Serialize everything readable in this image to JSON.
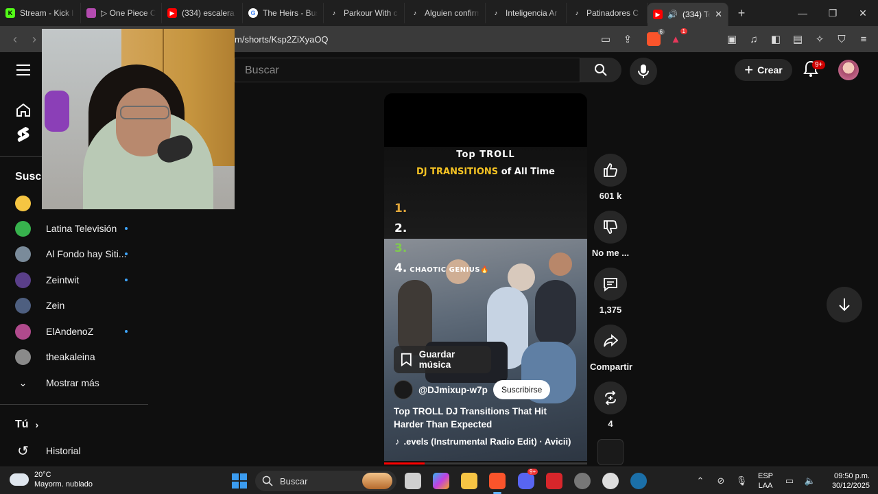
{
  "browser": {
    "tabs": [
      {
        "label": "Stream - Kick l",
        "fav": "kick",
        "color": "#53fc18"
      },
      {
        "label": "▷ One Piece C",
        "fav": "anime",
        "color": "#b44bb0"
      },
      {
        "label": "(334) escalera",
        "fav": "youtube",
        "color": "#ff0000"
      },
      {
        "label": "The Heirs - Bus",
        "fav": "google",
        "color": "#ffffff"
      },
      {
        "label": "Parkour With c",
        "fav": "tiktok",
        "color": "#000000"
      },
      {
        "label": "Alguien confirm",
        "fav": "tiktok",
        "color": "#000000"
      },
      {
        "label": "Inteligencia Ar",
        "fav": "tiktok",
        "color": "#000000"
      },
      {
        "label": "Patinadores C",
        "fav": "tiktok",
        "color": "#000000"
      },
      {
        "label": "(334) Te",
        "fav": "youtube",
        "color": "#ff0000",
        "active": true,
        "audio": true
      }
    ],
    "new_tab_icon": "plus-icon",
    "address": "m/shorts/Ksp2ZiXyaOQ",
    "brave_shield_count": "6",
    "rewards_count": "1"
  },
  "youtube": {
    "search_placeholder": "Buscar",
    "create_label": "Crear",
    "notifications_badge": "9+"
  },
  "sidebar": {
    "subscriptions_title": "Suscri",
    "subscriptions": [
      {
        "name": "",
        "color": "#f5c542",
        "new": false
      },
      {
        "name": "Latina Televisión",
        "color": "#37b24d",
        "new": true
      },
      {
        "name": "Al Fondo hay Siti...",
        "color": "#7a8b9a",
        "new": true
      },
      {
        "name": "Zeintwit",
        "color": "#5a3f8a",
        "new": true
      },
      {
        "name": "Zein",
        "color": "#4e5f80",
        "new": false
      },
      {
        "name": "ElAndenoZ",
        "color": "#b04a8c",
        "new": true
      },
      {
        "name": "theakaleina",
        "color": "#8a8a8a",
        "new": false
      }
    ],
    "show_more": "Mostrar más",
    "you_label": "Tú",
    "history_label": "Historial"
  },
  "short": {
    "overlay_line1": "Top TROLL",
    "overlay_line2_gold": "DJ TRANSITIONS",
    "overlay_line2_white": " of All Time",
    "ranks": [
      {
        "num": "1.",
        "color": "#e0a63a",
        "text": ""
      },
      {
        "num": "2.",
        "color": "#ffffff",
        "text": ""
      },
      {
        "num": "3.",
        "color": "#7fc94f",
        "text": ""
      },
      {
        "num": "4.",
        "color": "#ffffff",
        "text": "CHAOTIC GENIUS🔥"
      }
    ],
    "save_music": "Guardar música",
    "channel": "@DJmixup-w7p",
    "subscribe": "Suscribirse",
    "title": "Top TROLL DJ Transitions That Hit Harder Than Expected",
    "music": ".evels (Instrumental Radio Edit) · Avicii)",
    "progress": 0.2
  },
  "actions": {
    "likes": "601 k",
    "dislike": "No me ...",
    "comments": "1,375",
    "share": "Compartir",
    "remix": "4"
  },
  "taskbar": {
    "temp": "20°C",
    "weather": "Mayorm. nublado",
    "search": "Buscar",
    "lang1": "ESP",
    "lang2": "LAA",
    "time": "09:50 p.m.",
    "date": "30/12/2025",
    "discord_badge": "9+"
  }
}
